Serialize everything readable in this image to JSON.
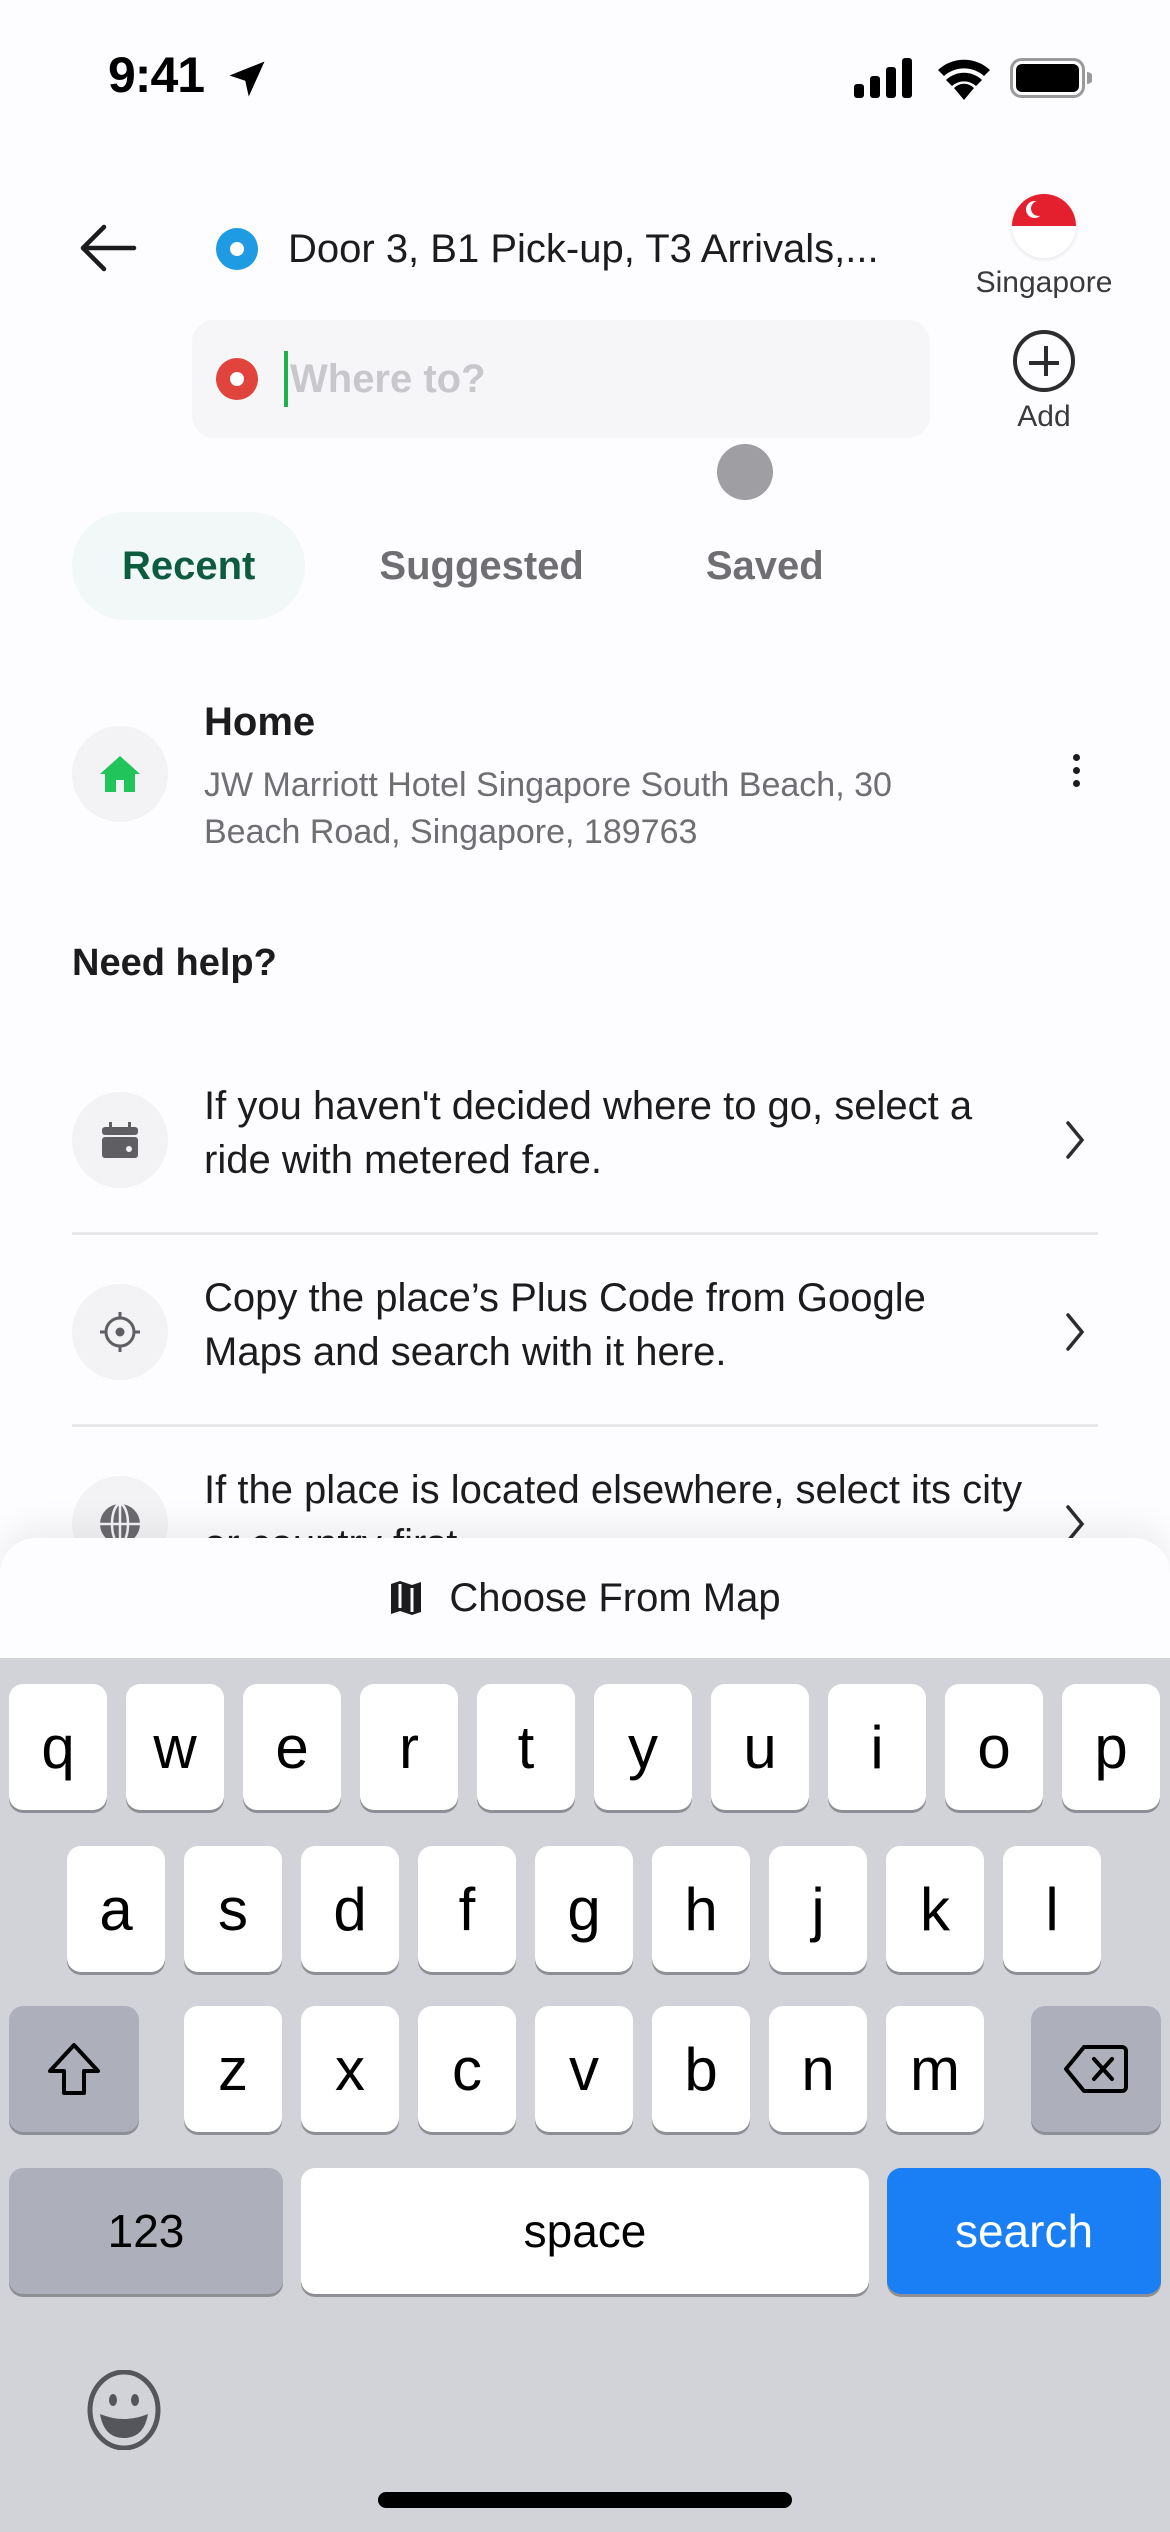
{
  "status_bar": {
    "time": "9:41",
    "icons": [
      "location-arrow-icon",
      "signal-icon",
      "wifi-icon",
      "battery-icon"
    ]
  },
  "header": {
    "back_icon": "arrow-left-icon",
    "pickup": {
      "text": "Door 3, B1 Pick-up, T3 Arrivals,...",
      "marker_color": "#1e9be3"
    },
    "destination": {
      "value": "",
      "placeholder": "Where to?",
      "marker_color": "#e0443c",
      "caret_color": "#21b14b"
    },
    "country": {
      "label": "Singapore",
      "icon": "singapore-flag-icon"
    },
    "add": {
      "label": "Add",
      "icon": "plus-circle-icon"
    }
  },
  "tabs": [
    {
      "label": "Recent",
      "active": true
    },
    {
      "label": "Suggested",
      "active": false
    },
    {
      "label": "Saved",
      "active": false
    }
  ],
  "saved_places": [
    {
      "icon": "home-icon",
      "title": "Home",
      "address": "JW Marriott Hotel Singapore South Beach, 30 Beach Road, Singapore, 189763"
    }
  ],
  "help": {
    "title": "Need help?",
    "items": [
      {
        "icon": "calendar-icon",
        "text": "If you haven't decided where to go, select a ride with metered fare."
      },
      {
        "icon": "crosshair-icon",
        "text": "Copy the place’s Plus Code from Google Maps and search with it here."
      },
      {
        "icon": "globe-icon",
        "text": "If the place is located elsewhere, select its city or country first."
      }
    ]
  },
  "map_sheet": {
    "icon": "map-icon",
    "label": "Choose From Map"
  },
  "keyboard": {
    "row1": [
      "q",
      "w",
      "e",
      "r",
      "t",
      "y",
      "u",
      "i",
      "o",
      "p"
    ],
    "row2": [
      "a",
      "s",
      "d",
      "f",
      "g",
      "h",
      "j",
      "k",
      "l"
    ],
    "row3": [
      "z",
      "x",
      "c",
      "v",
      "b",
      "n",
      "m"
    ],
    "numbers_label": "123",
    "space_label": "space",
    "return_label": "search",
    "accent_color": "#1a7ff5"
  },
  "colors": {
    "active_tab_text": "#0e5c40",
    "home_icon": "#21c45a"
  }
}
